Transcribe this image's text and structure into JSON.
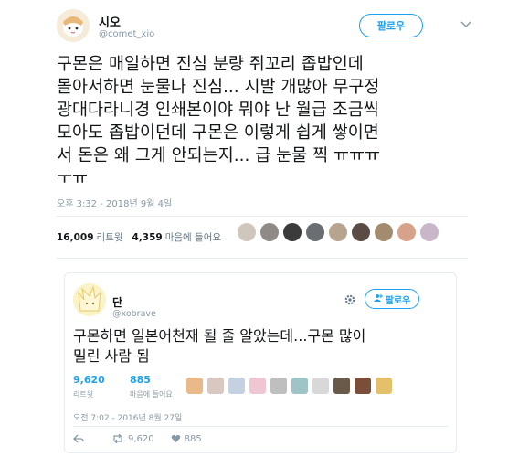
{
  "tweet1": {
    "name": "시오",
    "handle": "@comet_xio",
    "follow_label": "팔로우",
    "text": "구몬은 매일하면 진심 분량 쥐꼬리 좁밥인데\n몰아서하면 눈물나 진심... 시발 개많아 무구정\n광대다라니경 인쇄본이야 뭐야 난 월급 조금씩\n모아도 좁밥이던데 구몬은 이렇게 쉽게 쌓이면\n서 돈은 왜 그게 안되는지... 급 눈물 찍 ㅠㅠㅠ\nㅜㅠ",
    "timestamp": "오후 3:32 - 2018년 9월 4일",
    "retweets_count": "16,009",
    "retweets_label": "리트윗",
    "likes_count": "4,359",
    "likes_label": "마음에 들어요"
  },
  "tweet2": {
    "name": "단",
    "handle": "@xobrave",
    "follow_label": "팔로우",
    "text": "구몬하면 일본어천재 될 줄 알았는데...구몬 많이\n밀린 사람 됨",
    "retweets_count": "9,620",
    "retweets_label": "리트윗",
    "likes_count": "885",
    "likes_label": "마음에 들어요",
    "timestamp": "오전 7:02 - 2016년 8월 27일",
    "action_retweets": "9,620",
    "action_likes": "885"
  },
  "icons": [
    "chevron-down-icon",
    "settings-gear-icon",
    "add-user-icon",
    "reply-icon",
    "retweet-icon",
    "heart-icon"
  ],
  "colors": {
    "accent": "#1da1f2",
    "muted": "#8899a6",
    "text": "#14171a"
  }
}
